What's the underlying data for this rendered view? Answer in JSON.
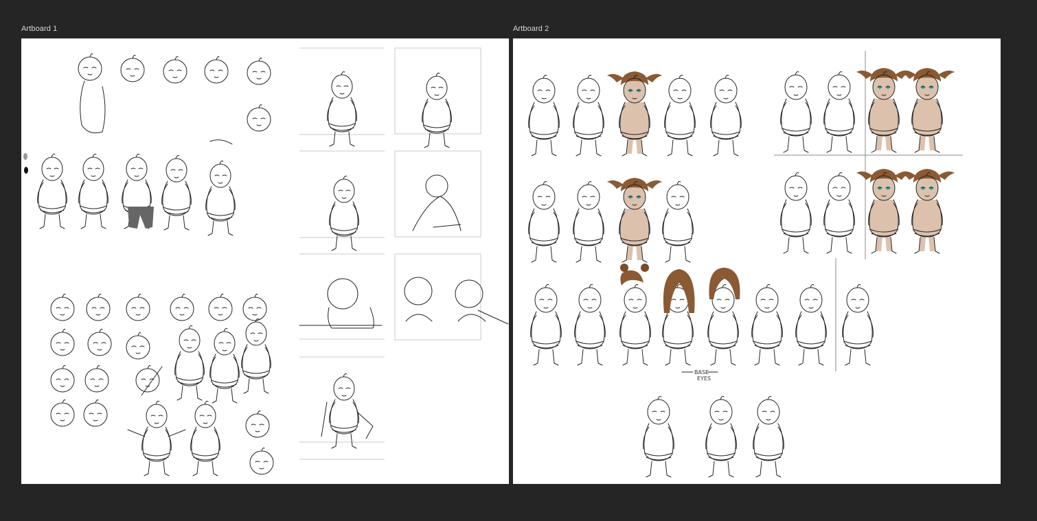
{
  "canvas": {
    "background": "#252525"
  },
  "artboards": [
    {
      "label": "Artboard 1"
    },
    {
      "label": "Artboard 2"
    }
  ],
  "notes": {
    "base_eyes_line1": "BASE",
    "base_eyes_line2": "EYES"
  },
  "colors": {
    "skin": "#dcc1ad",
    "hair": "#8a5a33",
    "eye": "#2aa7a0",
    "frame": "#c8c8c8"
  }
}
